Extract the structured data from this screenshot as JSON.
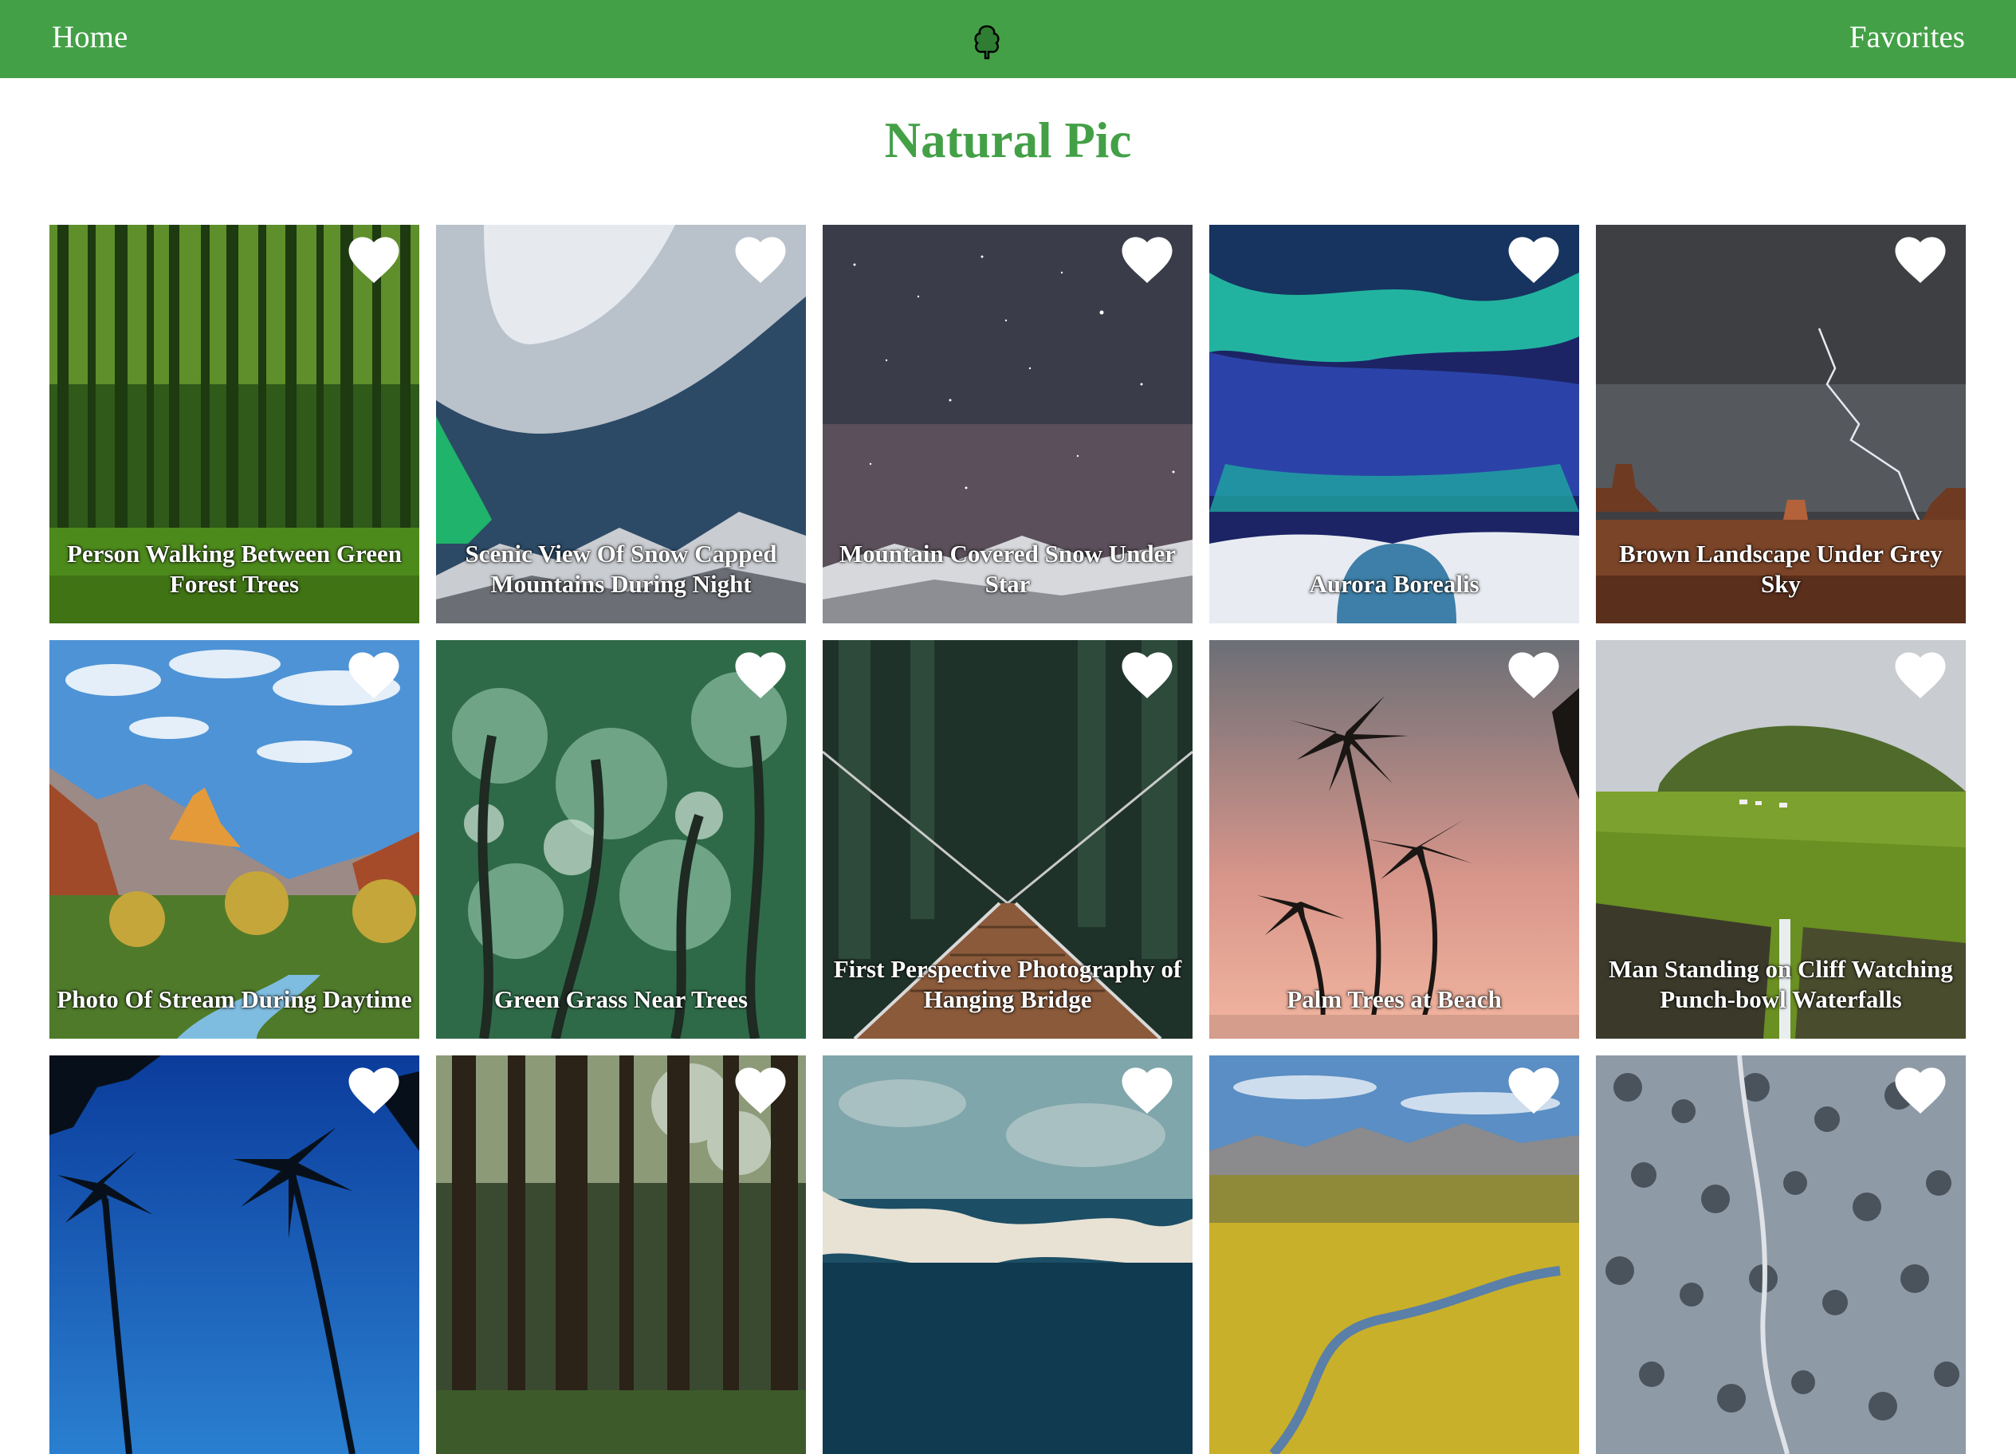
{
  "nav": {
    "home_label": "Home",
    "favorites_label": "Favorites",
    "logo_icon": "tree-icon",
    "bar_color": "#43a047"
  },
  "page": {
    "title": "Natural Pic",
    "title_color": "#43a047"
  },
  "cards": [
    {
      "title": "Person Walking Between Green Forest Trees",
      "favorite": false
    },
    {
      "title": "Scenic View Of Snow Capped Mountains During Night",
      "favorite": false
    },
    {
      "title": "Mountain Covered Snow Under Star",
      "favorite": false
    },
    {
      "title": "Aurora Borealis",
      "favorite": false
    },
    {
      "title": "Brown Landscape Under Grey Sky",
      "favorite": false
    },
    {
      "title": "Photo Of Stream During Daytime",
      "favorite": false
    },
    {
      "title": "Green Grass Near Trees",
      "favorite": false
    },
    {
      "title": "First Perspective Photography of Hanging Bridge",
      "favorite": false
    },
    {
      "title": "Palm Trees at Beach",
      "favorite": false
    },
    {
      "title": "Man Standing on Cliff Watching Punch-bowl Waterfalls",
      "favorite": false
    },
    {
      "title": "",
      "favorite": false
    },
    {
      "title": "",
      "favorite": false
    },
    {
      "title": "",
      "favorite": false
    },
    {
      "title": "",
      "favorite": false
    },
    {
      "title": "",
      "favorite": false
    }
  ],
  "heart_icon": "heart-icon",
  "heart_color": "#ffffff"
}
